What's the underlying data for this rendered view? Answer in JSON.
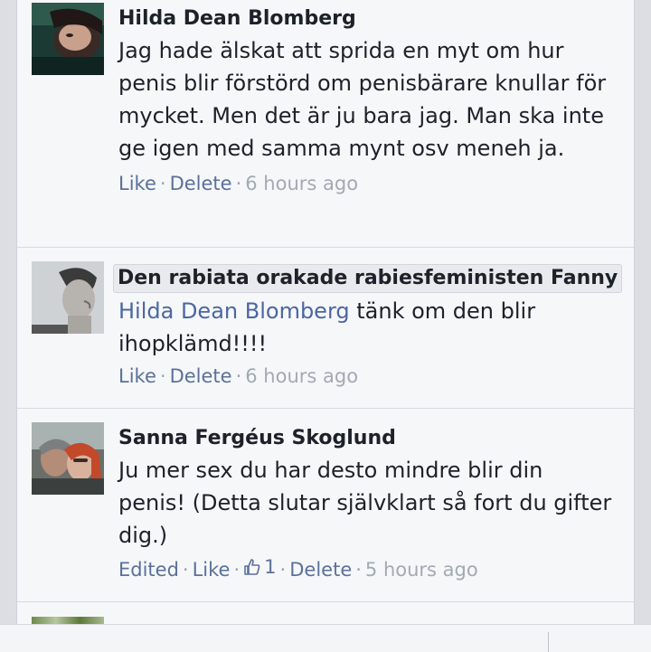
{
  "comments": [
    {
      "author": "Hilda Dean Blomberg",
      "text": "Jag hade älskat att sprida en myt om hur penis blir förstörd om penisbärare knullar för mycket. Men det är ju bara jag. Man ska inte ge igen med samma mynt osv meneh ja.",
      "like_label": "Like",
      "delete_label": "Delete",
      "time": "6 hours ago",
      "separator": "·"
    },
    {
      "author": "Den rabiata orakade rabiesfeministen Fanny",
      "mention": "Hilda Dean Blomberg",
      "text": " tänk om den blir ihopklämd!!!!",
      "like_label": "Like",
      "delete_label": "Delete",
      "time": "6 hours ago",
      "separator": "·"
    },
    {
      "author": "Sanna Fergéus Skoglund",
      "text": "Ju mer sex du har desto mindre blir din penis! (Detta slutar självklart så fort du gifter dig.)",
      "edited_label": "Edited",
      "like_label": "Like",
      "like_count": "1",
      "delete_label": "Delete",
      "time": "5 hours ago",
      "separator": "·"
    }
  ],
  "colors": {
    "link": "#5b7199",
    "mention": "#4b67a1",
    "timestamp": "#a3a9b3",
    "name": "#1d2129",
    "background": "#f6f7f9"
  },
  "icons": {
    "thumbs_up": "thumbs-up-icon"
  }
}
